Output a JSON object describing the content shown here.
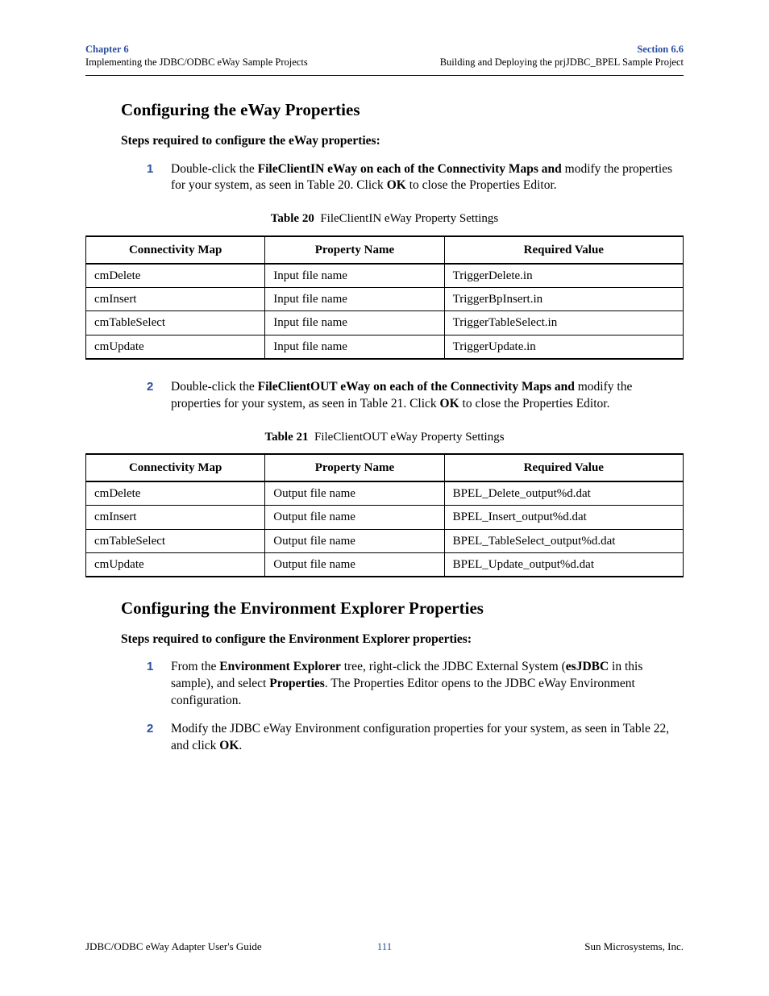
{
  "header": {
    "chapter_label": "Chapter 6",
    "chapter_sub": "Implementing the JDBC/ODBC eWay Sample Projects",
    "section_label": "Section 6.6",
    "section_sub": "Building and Deploying the prjJDBC_BPEL Sample Project"
  },
  "section1": {
    "heading": "Configuring the eWay Properties",
    "intro": "Steps required to configure the eWay properties:",
    "steps": [
      {
        "num": "1",
        "pre": "Double-click the ",
        "bold1": "FileClientIN eWay on each of the Connectivity Maps and ",
        "mid1": "modify the properties for your system, as seen in Table 20. Click ",
        "bold2": "OK",
        "post": " to close the Properties Editor."
      },
      {
        "num": "2",
        "pre": "Double-click the ",
        "bold1": "FileClientOUT eWay on each of the Connectivity Maps and ",
        "mid1": "modify the properties for your system, as seen in Table 21. Click ",
        "bold2": "OK",
        "post": " to close the Properties Editor."
      }
    ]
  },
  "table20": {
    "caption_num": "Table 20",
    "caption_text": "FileClientIN eWay Property Settings",
    "headers": [
      "Connectivity Map",
      "Property Name",
      "Required Value"
    ],
    "rows": [
      [
        "cmDelete",
        "Input file name",
        "TriggerDelete.in"
      ],
      [
        "cmInsert",
        "Input file name",
        "TriggerBpInsert.in"
      ],
      [
        "cmTableSelect",
        "Input file name",
        "TriggerTableSelect.in"
      ],
      [
        "cmUpdate",
        "Input file name",
        "TriggerUpdate.in"
      ]
    ]
  },
  "table21": {
    "caption_num": "Table 21",
    "caption_text": "FileClientOUT eWay Property Settings",
    "headers": [
      "Connectivity Map",
      "Property Name",
      "Required Value"
    ],
    "rows": [
      [
        "cmDelete",
        "Output file name",
        "BPEL_Delete_output%d.dat"
      ],
      [
        "cmInsert",
        "Output file name",
        "BPEL_Insert_output%d.dat"
      ],
      [
        "cmTableSelect",
        "Output file name",
        "BPEL_TableSelect_output%d.dat"
      ],
      [
        "cmUpdate",
        "Output file name",
        "BPEL_Update_output%d.dat"
      ]
    ]
  },
  "section2": {
    "heading": "Configuring the Environment Explorer Properties",
    "intro": "Steps required to configure the Environment Explorer properties:",
    "steps": [
      {
        "num": "1",
        "p1a": "From the ",
        "p1_bold1": "Environment Explorer",
        "p1b": " tree, right-click the JDBC External System (",
        "p1_bold2": "esJDBC",
        "p1c": " in this sample), and select ",
        "p1_bold3": "Properties",
        "p1d": ". The Properties Editor opens to the JDBC eWay Environment configuration."
      },
      {
        "num": "2",
        "p2a": "Modify the JDBC eWay Environment configuration properties for your system, as seen in Table 22, and click ",
        "p2_bold1": "OK",
        "p2b": "."
      }
    ]
  },
  "footer": {
    "left": "JDBC/ODBC eWay Adapter User's Guide",
    "center": "111",
    "right": "Sun Microsystems, Inc."
  }
}
